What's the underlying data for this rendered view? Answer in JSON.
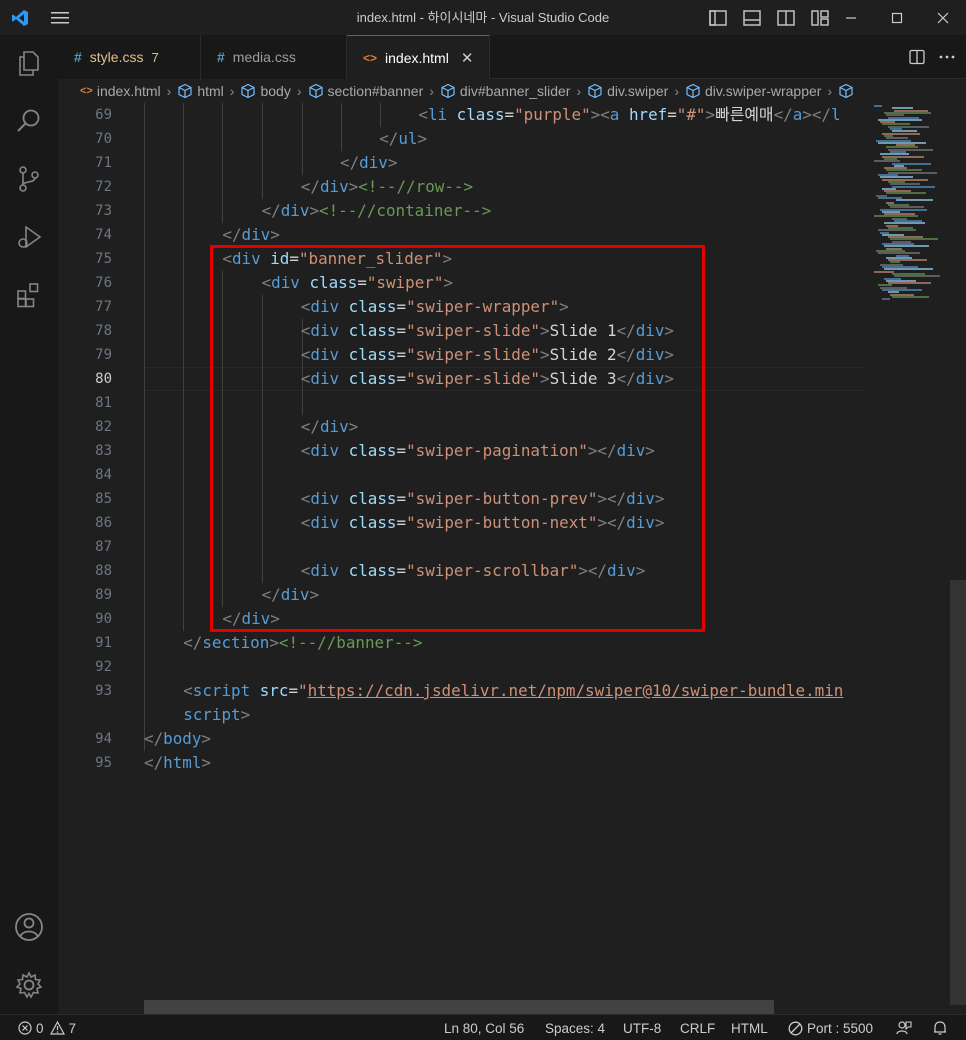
{
  "window": {
    "title": "index.html - 하이시네마 - Visual Studio Code"
  },
  "icons": {
    "app": "vscode-logo-icon",
    "menu": "hamburger-menu-icon",
    "layout": [
      "toggle-primary-sidebar-icon",
      "toggle-panel-icon",
      "toggle-secondary-sidebar-icon",
      "customize-layout-icon"
    ],
    "window": [
      "minimize-icon",
      "maximize-icon",
      "close-icon"
    ],
    "activity": [
      "explorer-icon",
      "search-icon",
      "source-control-icon",
      "run-debug-icon",
      "extensions-icon",
      "accounts-icon",
      "manage-gear-icon"
    ]
  },
  "tabs": [
    {
      "icon_text": "#",
      "label": "style.css",
      "badge": "7",
      "color": "#e2c08d",
      "icon_color": "#519aba"
    },
    {
      "icon_text": "#",
      "label": "media.css",
      "badge": "",
      "color": "#9d9d9d",
      "icon_color": "#519aba"
    },
    {
      "icon_text": "<>",
      "label": "index.html",
      "badge": "",
      "color": "#ffffff",
      "icon_color": "#e37933",
      "close": "✕"
    }
  ],
  "breadcrumb": [
    "index.html",
    "html",
    "body",
    "section#banner",
    "div#banner_slider",
    "div.swiper",
    "div.swiper-wrapper"
  ],
  "editor": {
    "line_numbers": [
      "69",
      "70",
      "71",
      "72",
      "73",
      "74",
      "75",
      "76",
      "77",
      "78",
      "79",
      "80",
      "81",
      "82",
      "83",
      "84",
      "85",
      "86",
      "87",
      "88",
      "89",
      "90",
      "91",
      "92",
      "93",
      "",
      "94",
      "95"
    ],
    "current_line": "80",
    "lines": [
      "<li class=\"purple\"><a href=\"#\">빠른예매</a></l",
      "</ul>",
      "</div>",
      "</div><!--//row-->",
      "</div><!--//container-->",
      "</div>",
      "<div id=\"banner_slider\">",
      "<div class=\"swiper\">",
      "<div class=\"swiper-wrapper\">",
      "<div class=\"swiper-slide\">Slide 1</div>",
      "<div class=\"swiper-slide\">Slide 2</div>",
      "<div class=\"swiper-slide\">Slide 3</div>",
      "",
      "</div>",
      "<div class=\"swiper-pagination\"></div>",
      "",
      "<div class=\"swiper-button-prev\"></div>",
      "<div class=\"swiper-button-next\"></div>",
      "",
      "<div class=\"swiper-scrollbar\"></div>",
      "</div>",
      "</div>",
      "</section><!--//banner-->",
      "",
      "<script src=\"https://cdn.jsdelivr.net/npm/swiper@10/swiper-bundle.min",
      "script>",
      "</body>",
      "</html>"
    ]
  },
  "statusbar": {
    "errors": "0",
    "warnings": "7",
    "position": "Ln 80, Col 56",
    "spaces": "Spaces: 4",
    "encoding": "UTF-8",
    "eol": "CRLF",
    "language": "HTML",
    "port": "Port : 5500"
  },
  "colors": {
    "accent": "#0078d4",
    "highlight_box": "#e50000",
    "tag": "#569cd6",
    "attribute": "#9cdcfe",
    "string": "#ce9178",
    "comment": "#6a9955"
  }
}
